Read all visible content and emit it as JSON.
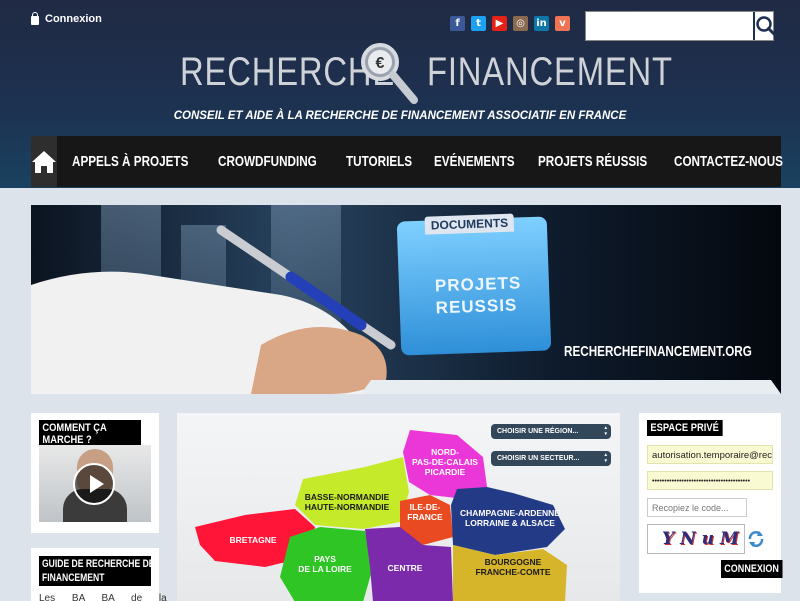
{
  "header": {
    "login_label": "Connexion",
    "logo_word_left": "RECHERCHE",
    "logo_word_right": "FINANCEMENT",
    "logo_euro": "€",
    "tagline": "CONSEIL ET AIDE À LA RECHERCHE DE FINANCEMENT ASSOCIATIF EN FRANCE",
    "social": [
      {
        "icon": "facebook-icon",
        "glyph": "f",
        "color": "#3b5998"
      },
      {
        "icon": "twitter-icon",
        "glyph": "t",
        "color": "#1da1f2"
      },
      {
        "icon": "youtube-icon",
        "glyph": "▶",
        "color": "#e62117"
      },
      {
        "icon": "instagram-icon",
        "glyph": "◎",
        "color": "#8a6a4f"
      },
      {
        "icon": "linkedin-icon",
        "glyph": "in",
        "color": "#0e76a8"
      },
      {
        "icon": "viadeo-icon",
        "glyph": "v",
        "color": "#f07355"
      }
    ],
    "search_value": ""
  },
  "nav": {
    "items": [
      "APPELS À PROJETS",
      "CROWDFUNDING",
      "TUTORIELS",
      "EVÉNEMENTS",
      "PROJETS RÉUSSIS",
      "CONTACTEZ-NOUS"
    ]
  },
  "banner": {
    "folder_label": "DOCUMENTS",
    "folder_text_1": "PROJETS",
    "folder_text_2": "REUSSIS",
    "url": "RECHERCHEFINANCEMENT.ORG"
  },
  "left": {
    "how_title": "COMMENT ÇA MARCHE ?",
    "guide_title_1": "GUIDE DE RECHERCHE DE",
    "guide_title_2": "FINANCEMENT",
    "guide_text": "Les BA BA de la"
  },
  "center": {
    "region_select": "CHOISIR UNE RÉGION...",
    "sector_select": "CHOISIR UN SECTEUR...",
    "regions": {
      "nord": "NORD-\nPAS-DE-CALAIS\nPICARDIE",
      "normandie": "BASSE-NORMANDIE\nHAUTE-NORMANDIE",
      "idf": "ILE-DE-\nFRANCE",
      "champagne": "CHAMPAGNE-ARDENNE\nLORRAINE & ALSACE",
      "bretagne": "BRETAGNE",
      "loire": "PAYS\nDE LA LOIRE",
      "centre": "CENTRE",
      "bourgogne": "BOURGOGNE\nFRANCHE-COMTE"
    }
  },
  "right": {
    "title": "ESPACE PRIVÉ",
    "username_value": "autorisation.temporaire@recherchefinancement.org",
    "password_value": "••••••••••••••••••••••••••••••••••••••••",
    "captcha_placeholder": "Recopiez le code...",
    "captcha_text": "YNuM",
    "login_button": "CONNEXION"
  }
}
